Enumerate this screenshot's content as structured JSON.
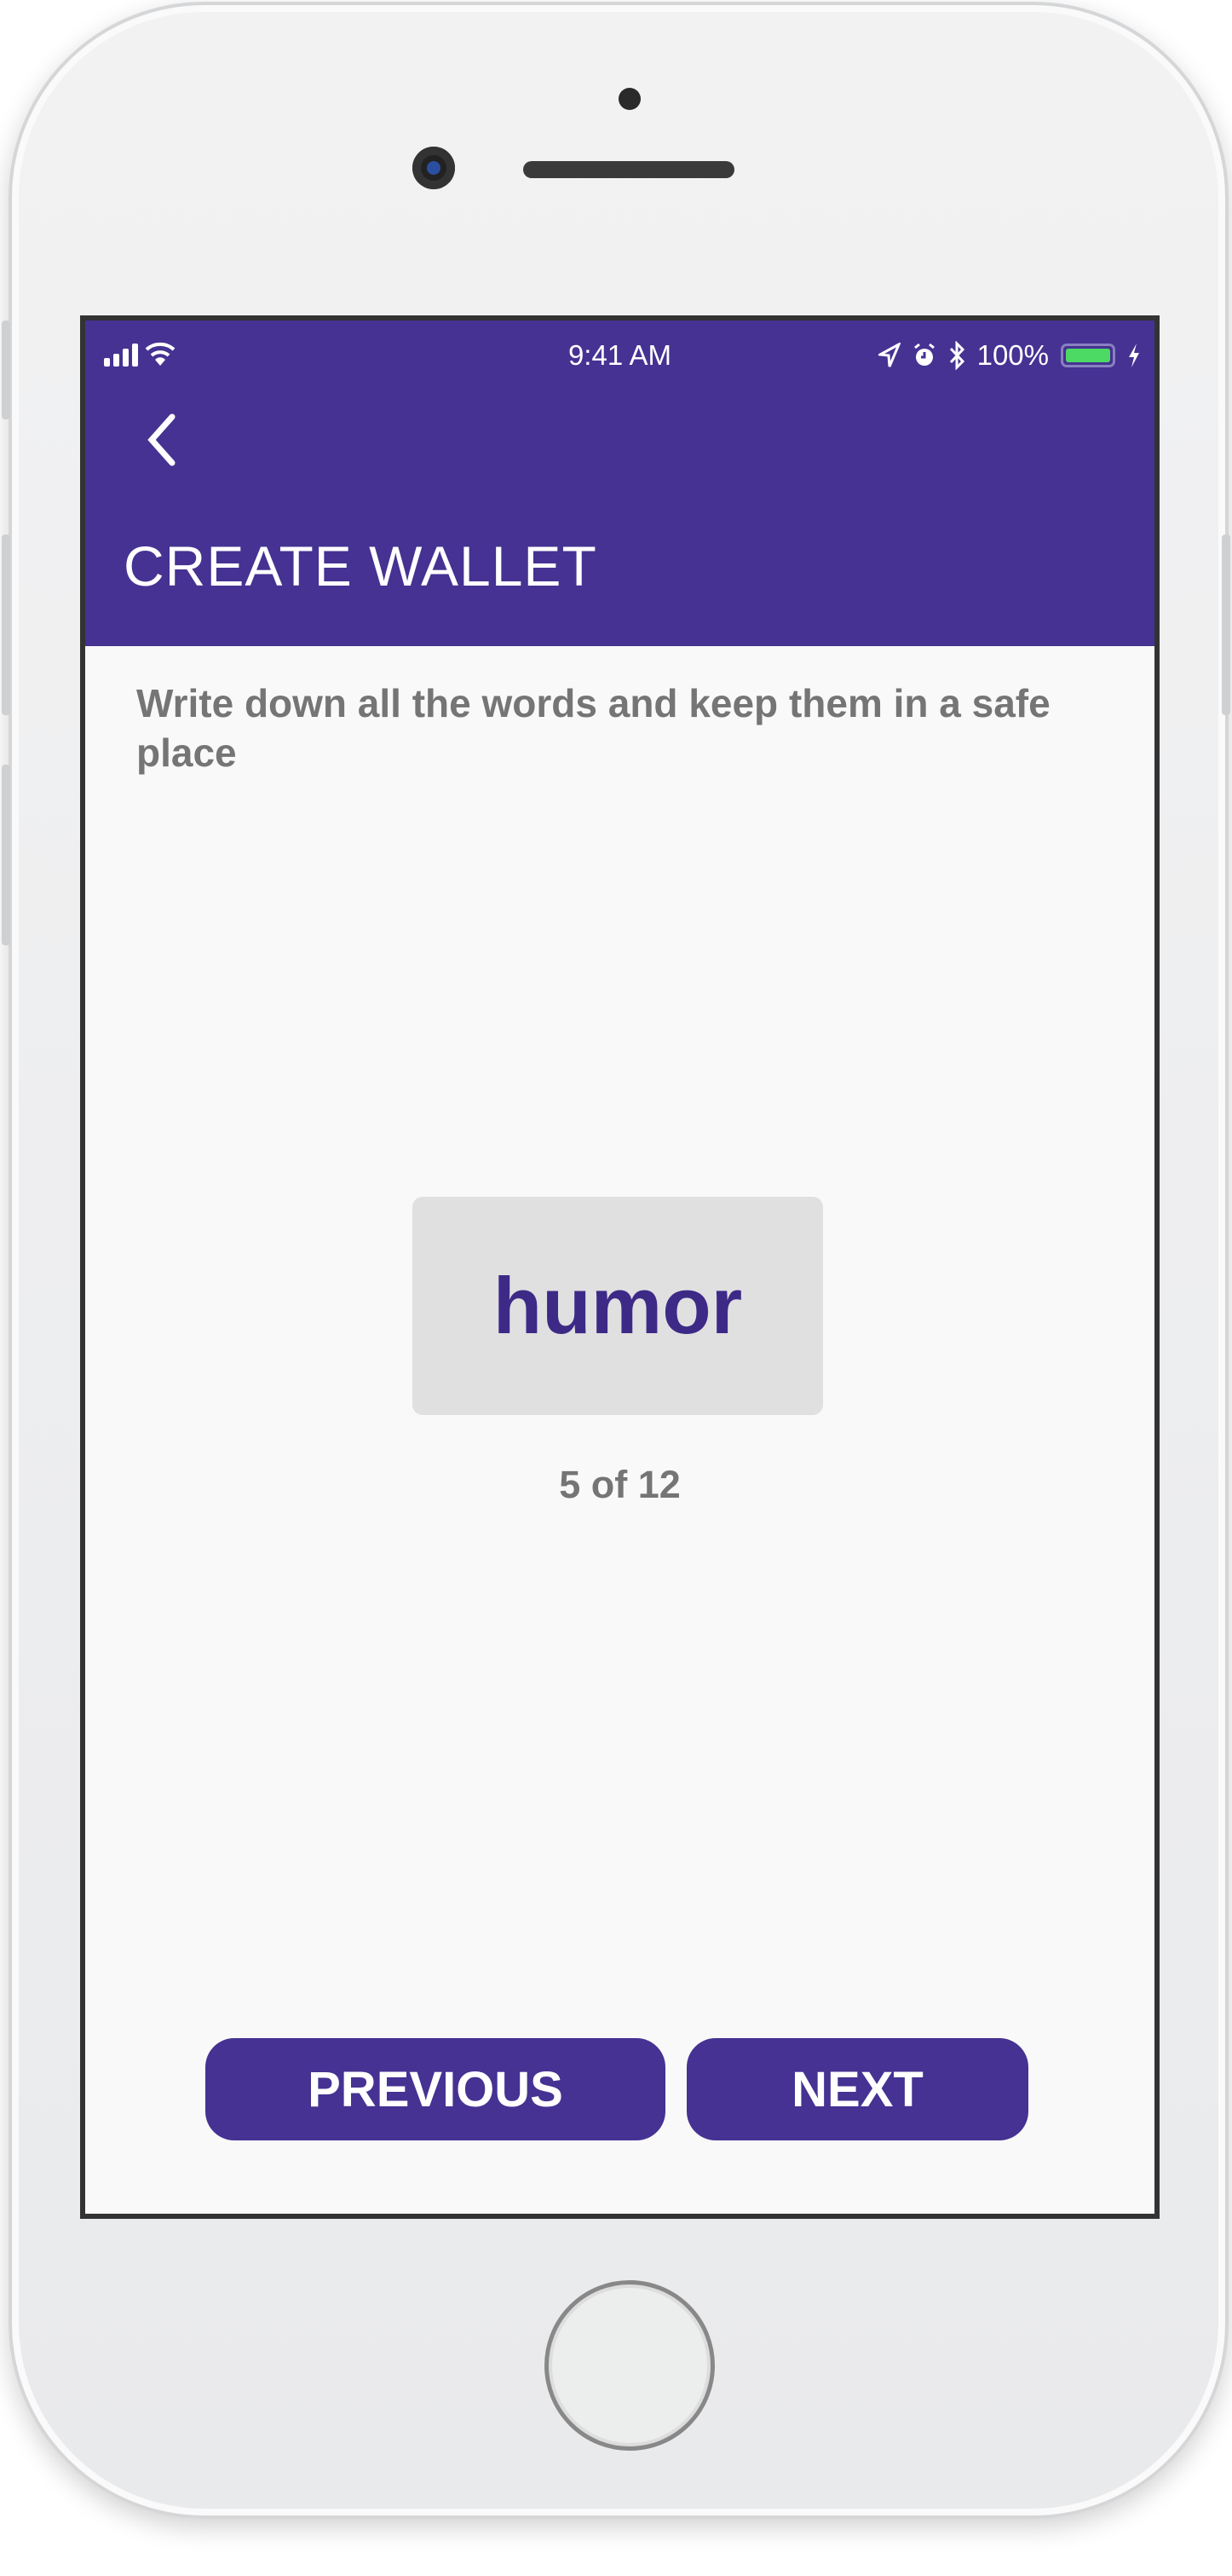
{
  "status_bar": {
    "time": "9:41 AM",
    "battery": "100%"
  },
  "header": {
    "title": "CREATE WALLET"
  },
  "main": {
    "instruction": "Write down all the words and keep them in a safe place",
    "word": "humor",
    "progress": "5 of 12"
  },
  "buttons": {
    "previous": "PREVIOUS",
    "next": "NEXT"
  },
  "colors": {
    "primary": "#453292",
    "word": "#3d2a87",
    "battery": "#4cd964"
  }
}
